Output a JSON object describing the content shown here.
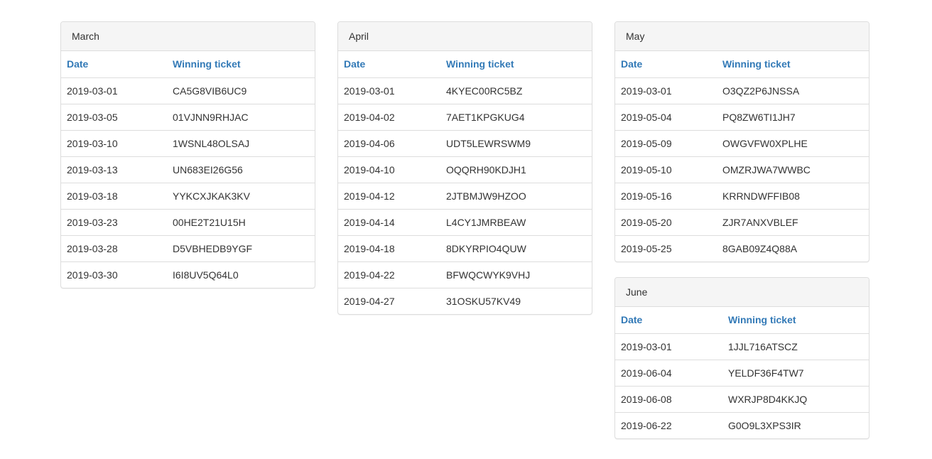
{
  "panels": [
    {
      "id": "march",
      "title": "March",
      "headers": {
        "date": "Date",
        "ticket": "Winning ticket"
      },
      "rows": [
        {
          "date": "2019-03-01",
          "ticket": "CA5G8VIB6UC9"
        },
        {
          "date": "2019-03-05",
          "ticket": "01VJNN9RHJAC"
        },
        {
          "date": "2019-03-10",
          "ticket": "1WSNL48OLSAJ"
        },
        {
          "date": "2019-03-13",
          "ticket": "UN683EI26G56"
        },
        {
          "date": "2019-03-18",
          "ticket": "YYKCXJKAK3KV"
        },
        {
          "date": "2019-03-23",
          "ticket": "00HE2T21U15H"
        },
        {
          "date": "2019-03-28",
          "ticket": "D5VBHEDB9YGF"
        },
        {
          "date": "2019-03-30",
          "ticket": "I6I8UV5Q64L0"
        }
      ]
    },
    {
      "id": "april",
      "title": "April",
      "headers": {
        "date": "Date",
        "ticket": "Winning ticket"
      },
      "rows": [
        {
          "date": "2019-03-01",
          "ticket": "4KYEC00RC5BZ"
        },
        {
          "date": "2019-04-02",
          "ticket": "7AET1KPGKUG4"
        },
        {
          "date": "2019-04-06",
          "ticket": "UDT5LEWRSWM9"
        },
        {
          "date": "2019-04-10",
          "ticket": "OQQRH90KDJH1"
        },
        {
          "date": "2019-04-12",
          "ticket": "2JTBMJW9HZOO"
        },
        {
          "date": "2019-04-14",
          "ticket": "L4CY1JMRBEAW"
        },
        {
          "date": "2019-04-18",
          "ticket": "8DKYRPIO4QUW"
        },
        {
          "date": "2019-04-22",
          "ticket": "BFWQCWYK9VHJ"
        },
        {
          "date": "2019-04-27",
          "ticket": "31OSKU57KV49"
        }
      ]
    },
    {
      "id": "may",
      "title": "May",
      "headers": {
        "date": "Date",
        "ticket": "Winning ticket"
      },
      "rows": [
        {
          "date": "2019-03-01",
          "ticket": "O3QZ2P6JNSSA"
        },
        {
          "date": "2019-05-04",
          "ticket": "PQ8ZW6TI1JH7"
        },
        {
          "date": "2019-05-09",
          "ticket": "OWGVFW0XPLHE"
        },
        {
          "date": "2019-05-10",
          "ticket": "OMZRJWA7WWBC"
        },
        {
          "date": "2019-05-16",
          "ticket": "KRRNDWFFIB08"
        },
        {
          "date": "2019-05-20",
          "ticket": "ZJR7ANXVBLEF"
        },
        {
          "date": "2019-05-25",
          "ticket": "8GAB09Z4Q88A"
        }
      ]
    },
    {
      "id": "june",
      "title": "June",
      "headers": {
        "date": "Date",
        "ticket": "Winning ticket"
      },
      "rows": [
        {
          "date": "2019-03-01",
          "ticket": "1JJL716ATSCZ"
        },
        {
          "date": "2019-06-04",
          "ticket": "YELDF36F4TW7"
        },
        {
          "date": "2019-06-08",
          "ticket": "WXRJP8D4KKJQ"
        },
        {
          "date": "2019-06-22",
          "ticket": "G0O9L3XPS3IR"
        }
      ]
    }
  ],
  "colors": {
    "header_link": "#337ab7",
    "panel_heading_bg": "#f5f5f5",
    "border": "#dddddd",
    "text": "#333333"
  }
}
